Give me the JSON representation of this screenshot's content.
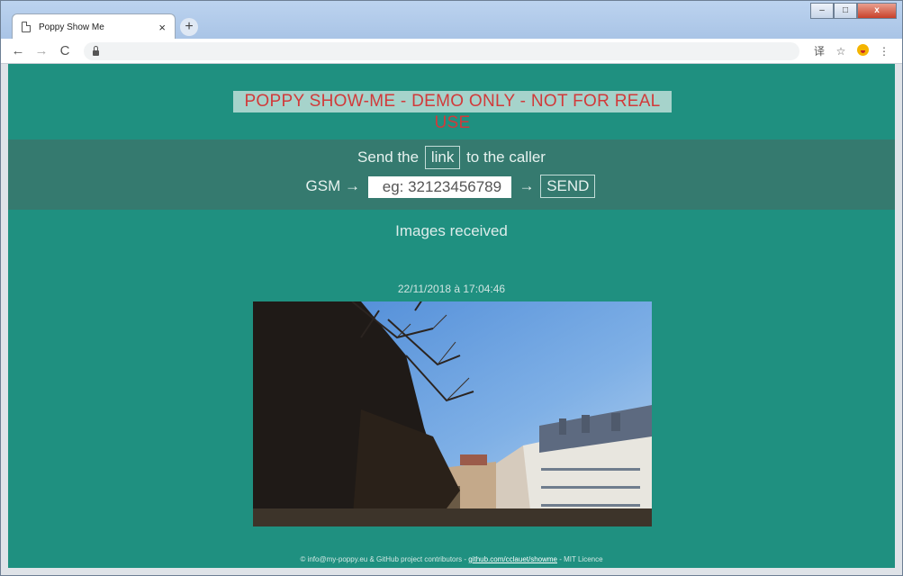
{
  "browser": {
    "tab_title": "Poppy Show Me",
    "tab_close": "×",
    "new_tab": "+",
    "nav_back": "←",
    "nav_forward": "→",
    "nav_reload": "C",
    "win_minimize": "–",
    "win_maximize": "□",
    "win_close": "x",
    "star": "☆",
    "menu": "⋮",
    "translate": "译"
  },
  "page": {
    "banner": "POPPY SHOW-ME - DEMO ONLY - NOT FOR REAL USE",
    "send_prefix": "Send the",
    "send_link": "link",
    "send_suffix": "to the caller",
    "gsm_label": "GSM →",
    "gsm_placeholder": "eg: 32123456789",
    "arrow": "→",
    "send_button": "SEND",
    "images_received": "Images received",
    "timestamp": "22/11/2018 à 17:04:46",
    "footer_prefix": "© info@my-poppy.eu & GitHub project contributors - ",
    "footer_link": "github.com/cclauet/showme",
    "footer_suffix": " - MIT Licence"
  },
  "colors": {
    "page_bg": "#1f9080",
    "band_bg": "#357a6f",
    "banner_text": "#d13a3a",
    "banner_bg": "#a6d3cb"
  }
}
